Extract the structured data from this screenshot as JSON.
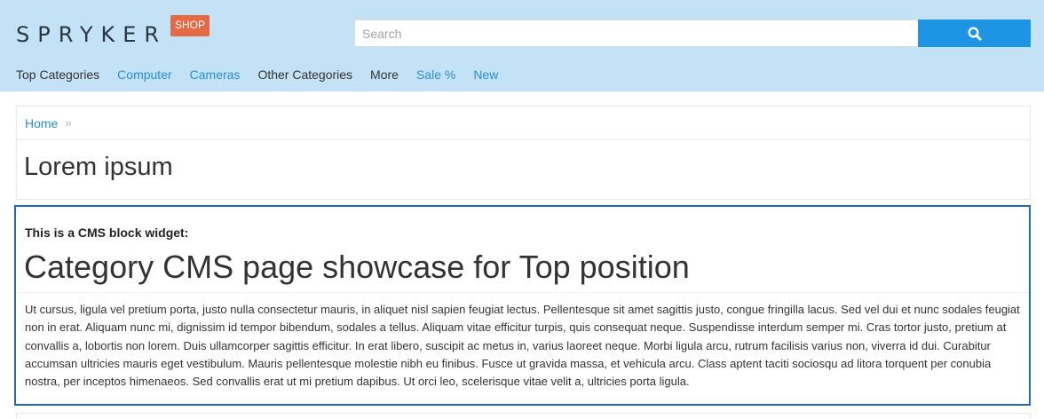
{
  "header": {
    "logo_text": "SPRYKER",
    "logo_badge": "SHOP",
    "search": {
      "placeholder": "Search",
      "value": ""
    },
    "search_button_icon": "search-icon"
  },
  "nav": {
    "items": [
      {
        "label": "Top Categories",
        "color": "#333333"
      },
      {
        "label": "Computer",
        "color": "#2a8ed6"
      },
      {
        "label": "Cameras",
        "color": "#2a8ed6"
      },
      {
        "label": "Other Categories",
        "color": "#333333"
      },
      {
        "label": "More",
        "color": "#333333"
      },
      {
        "label": "Sale %",
        "color": "#2a8ed6"
      },
      {
        "label": "New",
        "color": "#2a8ed6"
      }
    ]
  },
  "breadcrumb": {
    "home": "Home",
    "separator": "»"
  },
  "page": {
    "title": "Lorem ipsum"
  },
  "cms_block": {
    "label": "This is a CMS block widget:",
    "heading": "Category CMS page showcase for Top position",
    "body": "Ut cursus, ligula vel pretium porta, justo nulla consectetur mauris, in aliquet nisl sapien feugiat lectus. Pellentesque sit amet sagittis justo, congue fringilla lacus. Sed vel dui et nunc sodales feugiat non in erat. Aliquam nunc mi, dignissim id tempor bibendum, sodales a tellus. Aliquam vitae efficitur turpis, quis consequat neque. Suspendisse interdum semper mi. Cras tortor justo, pretium at convallis a, lobortis non lorem. Duis ullamcorper sagittis efficitur. In erat libero, suscipit ac metus in, varius laoreet neque. Morbi ligula arcu, rutrum facilisis varius non, viverra id dui. Curabitur accumsan ultricies mauris eget vestibulum. Mauris pellentesque molestie nibh eu finibus. Fusce ut gravida massa, et vehicula arcu. Class aptent taciti sociosqu ad litora torquent per conubia nostra, per inceptos himenaeos. Sed convallis erat ut mi pretium dapibus. Ut orci leo, scelerisque vitae velit a, ultricies porta ligula."
  },
  "colors": {
    "header_bg": "#c4e2f6",
    "accent_blue": "#1e95e4",
    "link_blue": "#2a8ed6",
    "badge_orange": "#e46a46",
    "cms_border": "#1f6ab3"
  }
}
